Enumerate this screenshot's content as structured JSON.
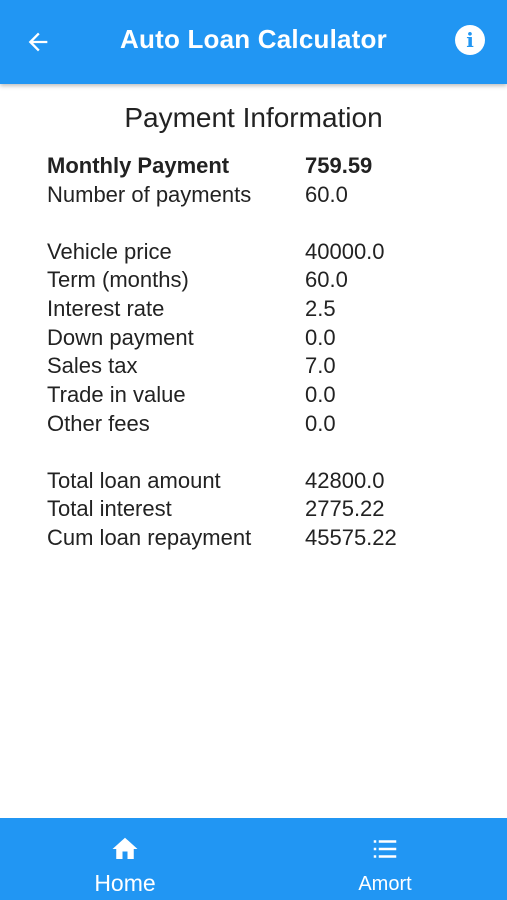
{
  "app_bar": {
    "title": "Auto Loan Calculator",
    "back_icon": "arrow-left-icon",
    "info_icon": "info-icon",
    "info_glyph": "i"
  },
  "section": {
    "title": "Payment Information"
  },
  "summary": [
    {
      "label": "Monthly Payment",
      "value": "759.59"
    },
    {
      "label": "Number of payments",
      "value": "60.0"
    }
  ],
  "inputs": [
    {
      "label": "Vehicle price",
      "value": "40000.0"
    },
    {
      "label": "Term (months)",
      "value": "60.0"
    },
    {
      "label": "Interest rate",
      "value": "2.5"
    },
    {
      "label": "Down payment",
      "value": "0.0"
    },
    {
      "label": "Sales tax",
      "value": "7.0"
    },
    {
      "label": "Trade in value",
      "value": "0.0"
    },
    {
      "label": "Other fees",
      "value": "0.0"
    }
  ],
  "totals": [
    {
      "label": "Total loan amount",
      "value": "42800.0"
    },
    {
      "label": "Total interest",
      "value": "2775.22"
    },
    {
      "label": "Cum loan repayment",
      "value": "45575.22"
    }
  ],
  "bottom_nav": {
    "home_label": "Home",
    "home_icon": "home-icon",
    "amort_label": "Amort",
    "amort_icon": "list-icon"
  },
  "colors": {
    "primary": "#2196F3",
    "on_primary": "#ffffff",
    "text": "#222222"
  }
}
